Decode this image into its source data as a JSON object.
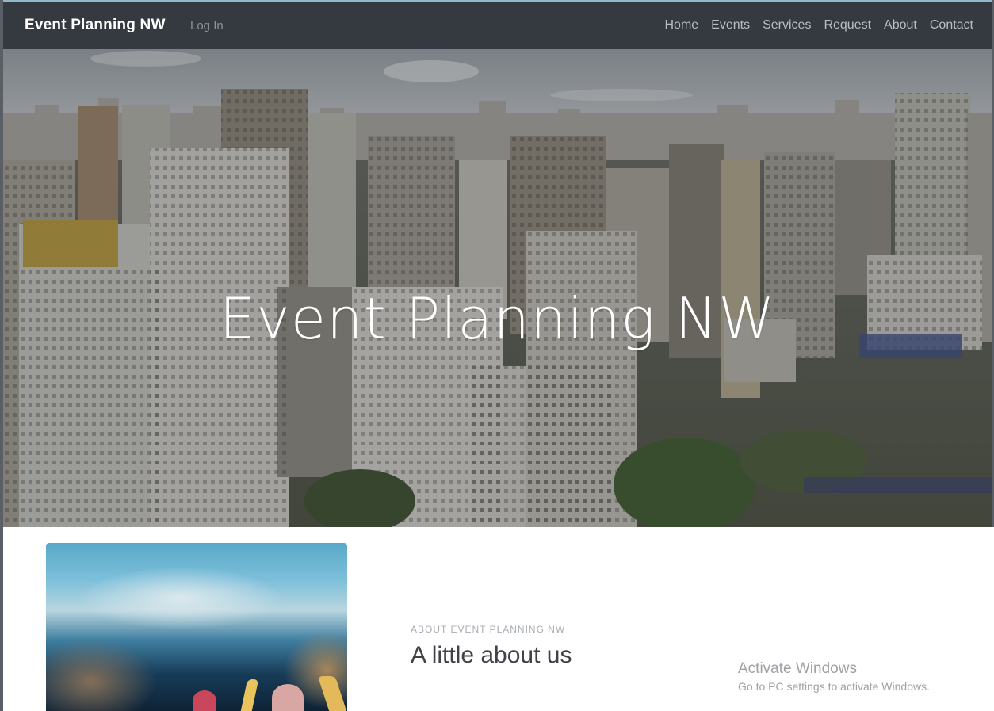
{
  "navbar": {
    "brand": "Event Planning NW",
    "login": "Log In",
    "links": [
      "Home",
      "Events",
      "Services",
      "Request",
      "About",
      "Contact"
    ]
  },
  "hero": {
    "title": "Event Planning NW"
  },
  "about": {
    "kicker": "ABOUT EVENT PLANNING NW",
    "heading": "A little about us"
  },
  "watermark": {
    "title": "Activate Windows",
    "subtitle": "Go to PC settings to activate Windows."
  },
  "colors": {
    "navbar_bg": "#353a40",
    "brand_text": "#ffffff",
    "nav_link": "#b9bcc0",
    "login_text": "#8d9196"
  }
}
